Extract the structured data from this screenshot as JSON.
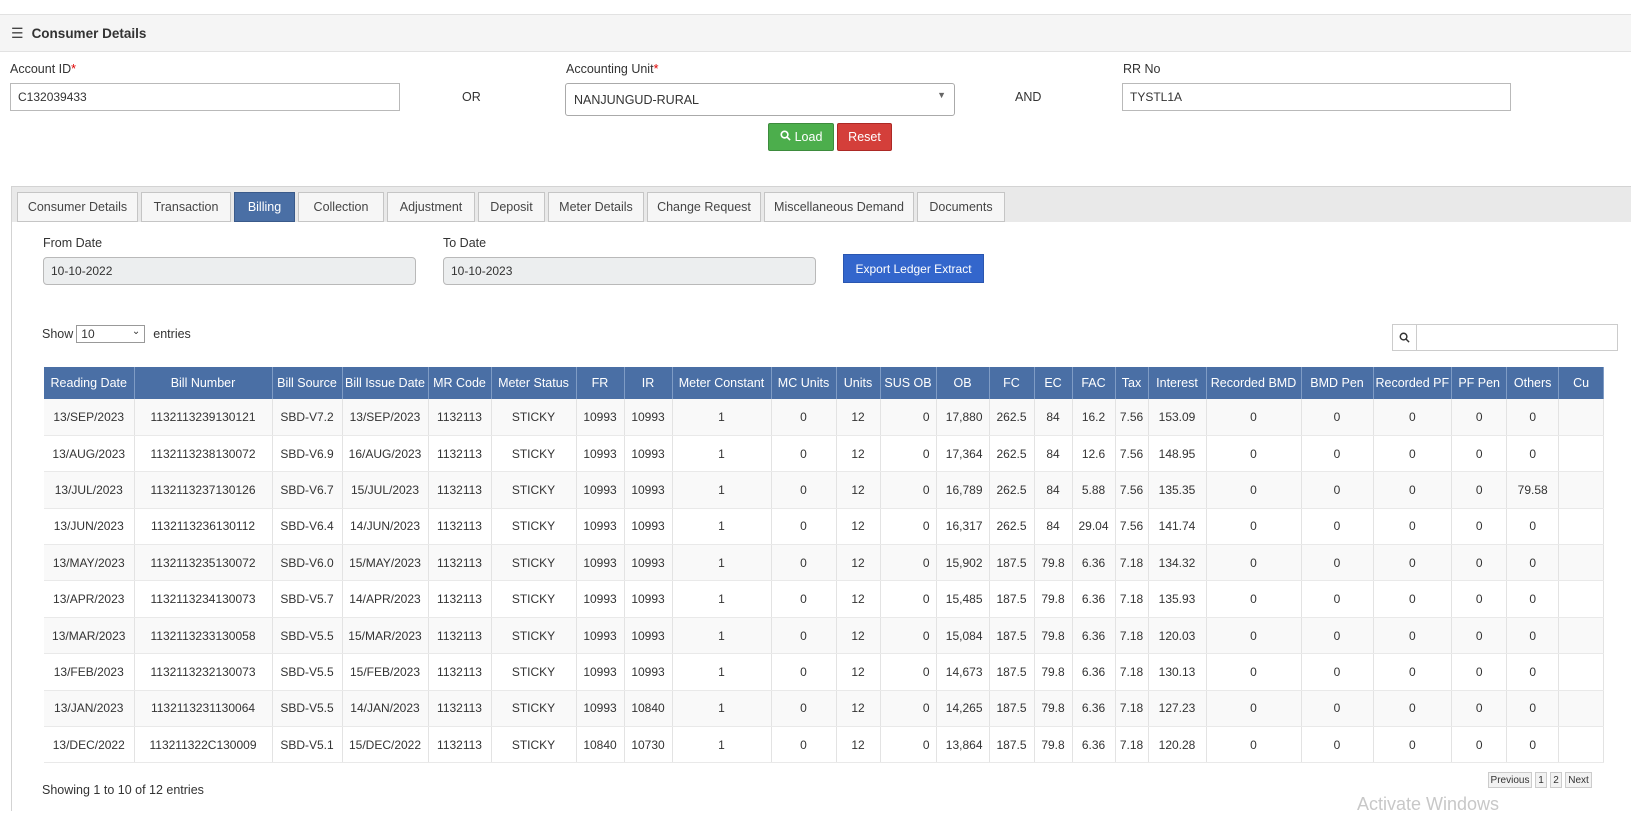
{
  "header": {
    "title": "Consumer Details",
    "menu_icon": "hamburger-icon"
  },
  "form": {
    "account_id_label": "Account ID",
    "account_id_value": "C132039433",
    "or_text": "OR",
    "accounting_unit_label": "Accounting Unit",
    "accounting_unit_value": "NANJUNGUD-RURAL",
    "and_text": "AND",
    "rr_no_label": "RR No",
    "rr_no_value": "TYSTL1A",
    "load_label": "Load",
    "reset_label": "Reset",
    "required_mark": "*"
  },
  "tabs": [
    {
      "label": "Consumer Details"
    },
    {
      "label": "Transaction"
    },
    {
      "label": "Billing",
      "active": true
    },
    {
      "label": "Collection"
    },
    {
      "label": "Adjustment"
    },
    {
      "label": "Deposit"
    },
    {
      "label": "Meter Details"
    },
    {
      "label": "Change Request"
    },
    {
      "label": "Miscellaneous Demand"
    },
    {
      "label": "Documents"
    }
  ],
  "billing": {
    "from_date_label": "From Date",
    "from_date_value": "10-10-2022",
    "to_date_label": "To Date",
    "to_date_value": "10-10-2023",
    "export_label": "Export Ledger Extract",
    "show_label": "Show",
    "entries_label": "entries",
    "page_length": "10",
    "columns": [
      "Reading Date",
      "Bill Number",
      "Bill Source",
      "Bill Issue Date",
      "MR Code",
      "Meter Status",
      "FR",
      "IR",
      "Meter Constant",
      "MC Units",
      "Units",
      "SUS OB",
      "OB",
      "FC",
      "EC",
      "FAC",
      "Tax",
      "Interest",
      "Recorded BMD",
      "BMD Pen",
      "Recorded PF",
      "PF Pen",
      "Others",
      "Cu"
    ],
    "rows": [
      [
        "13/SEP/2023",
        "1132113239130121",
        "SBD-V7.2",
        "13/SEP/2023",
        "1132113",
        "STICKY",
        "10993",
        "10993",
        "1",
        "0",
        "12",
        "0",
        "17,880",
        "262.5",
        "84",
        "16.2",
        "7.56",
        "153.09",
        "0",
        "0",
        "0",
        "0",
        "0",
        ""
      ],
      [
        "13/AUG/2023",
        "1132113238130072",
        "SBD-V6.9",
        "16/AUG/2023",
        "1132113",
        "STICKY",
        "10993",
        "10993",
        "1",
        "0",
        "12",
        "0",
        "17,364",
        "262.5",
        "84",
        "12.6",
        "7.56",
        "148.95",
        "0",
        "0",
        "0",
        "0",
        "0",
        ""
      ],
      [
        "13/JUL/2023",
        "1132113237130126",
        "SBD-V6.7",
        "15/JUL/2023",
        "1132113",
        "STICKY",
        "10993",
        "10993",
        "1",
        "0",
        "12",
        "0",
        "16,789",
        "262.5",
        "84",
        "5.88",
        "7.56",
        "135.35",
        "0",
        "0",
        "0",
        "0",
        "79.58",
        ""
      ],
      [
        "13/JUN/2023",
        "1132113236130112",
        "SBD-V6.4",
        "14/JUN/2023",
        "1132113",
        "STICKY",
        "10993",
        "10993",
        "1",
        "0",
        "12",
        "0",
        "16,317",
        "262.5",
        "84",
        "29.04",
        "7.56",
        "141.74",
        "0",
        "0",
        "0",
        "0",
        "0",
        ""
      ],
      [
        "13/MAY/2023",
        "1132113235130072",
        "SBD-V6.0",
        "15/MAY/2023",
        "1132113",
        "STICKY",
        "10993",
        "10993",
        "1",
        "0",
        "12",
        "0",
        "15,902",
        "187.5",
        "79.8",
        "6.36",
        "7.18",
        "134.32",
        "0",
        "0",
        "0",
        "0",
        "0",
        ""
      ],
      [
        "13/APR/2023",
        "1132113234130073",
        "SBD-V5.7",
        "14/APR/2023",
        "1132113",
        "STICKY",
        "10993",
        "10993",
        "1",
        "0",
        "12",
        "0",
        "15,485",
        "187.5",
        "79.8",
        "6.36",
        "7.18",
        "135.93",
        "0",
        "0",
        "0",
        "0",
        "0",
        ""
      ],
      [
        "13/MAR/2023",
        "1132113233130058",
        "SBD-V5.5",
        "15/MAR/2023",
        "1132113",
        "STICKY",
        "10993",
        "10993",
        "1",
        "0",
        "12",
        "0",
        "15,084",
        "187.5",
        "79.8",
        "6.36",
        "7.18",
        "120.03",
        "0",
        "0",
        "0",
        "0",
        "0",
        ""
      ],
      [
        "13/FEB/2023",
        "1132113232130073",
        "SBD-V5.5",
        "15/FEB/2023",
        "1132113",
        "STICKY",
        "10993",
        "10993",
        "1",
        "0",
        "12",
        "0",
        "14,673",
        "187.5",
        "79.8",
        "6.36",
        "7.18",
        "130.13",
        "0",
        "0",
        "0",
        "0",
        "0",
        ""
      ],
      [
        "13/JAN/2023",
        "1132113231130064",
        "SBD-V5.5",
        "14/JAN/2023",
        "1132113",
        "STICKY",
        "10993",
        "10840",
        "1",
        "0",
        "12",
        "0",
        "14,265",
        "187.5",
        "79.8",
        "6.36",
        "7.18",
        "127.23",
        "0",
        "0",
        "0",
        "0",
        "0",
        ""
      ],
      [
        "13/DEC/2022",
        "113211322C130009",
        "SBD-V5.1",
        "15/DEC/2022",
        "1132113",
        "STICKY",
        "10840",
        "10730",
        "1",
        "0",
        "12",
        "0",
        "13,864",
        "187.5",
        "79.8",
        "6.36",
        "7.18",
        "120.28",
        "0",
        "0",
        "0",
        "0",
        "0",
        ""
      ]
    ],
    "info_text": "Showing 1 to 10 of 12 entries",
    "pagination": {
      "previous": "Previous",
      "pages": [
        "1",
        "2"
      ],
      "next": "Next"
    }
  },
  "watermark": "Activate Windows",
  "colors": {
    "header_blue": "#4a6fa5",
    "load_green": "#4cae4c",
    "reset_red": "#d43f3a",
    "export_blue": "#3366cc"
  }
}
